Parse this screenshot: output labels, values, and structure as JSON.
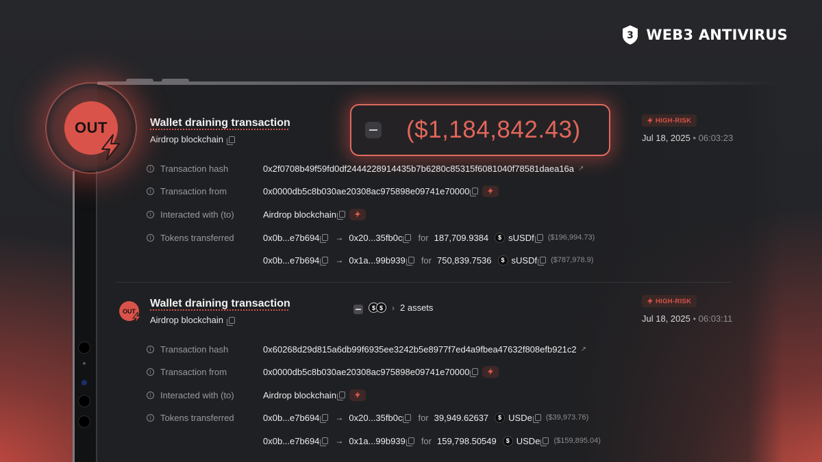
{
  "brand": {
    "name": "WEB3 ANTIVIRUS"
  },
  "colors": {
    "accent": "#d9534a",
    "background": "#1f2023",
    "text": "#ececee"
  },
  "transactions": [
    {
      "direction": "OUT",
      "title": "Wallet draining transaction",
      "chain": "Airdrop blockchain",
      "amount": "($1,184,842.43)",
      "risk": "HIGH-RISK",
      "date": "Jul 18, 2025",
      "time": "06:03:23",
      "labels": {
        "hash": "Transaction hash",
        "from": "Transaction from",
        "to": "Interacted with (to)",
        "tokens": "Tokens transferred"
      },
      "hash": "0x2f0708b49f59fd0df2444228914435b7b6280c85315f6081040f78581daea16a",
      "from": "0x0000db5c8b030ae20308ac975898e09741e70000",
      "to": "Airdrop blockchain",
      "transfers": [
        {
          "from": "0x0b...e7b694",
          "to": "0x20...35fb0c",
          "for": "for",
          "amount": "187,709.9384",
          "token": "sUSDf",
          "usd": "($196,994.73)",
          "icon": "dollar-slash-icon"
        },
        {
          "from": "0x0b...e7b694",
          "to": "0x1a...99b939",
          "for": "for",
          "amount": "750,839.7536",
          "token": "sUSDf",
          "usd": "($787,978.9)",
          "icon": "dollar-slash-icon"
        }
      ]
    },
    {
      "direction": "OUT",
      "title": "Wallet draining transaction",
      "chain": "Airdrop blockchain",
      "assets": "2 assets",
      "risk": "HIGH-RISK",
      "date": "Jul 18, 2025",
      "time": "06:03:11",
      "labels": {
        "hash": "Transaction hash",
        "from": "Transaction from",
        "to": "Interacted with (to)",
        "tokens": "Tokens transferred"
      },
      "hash": "0x60268d29d815a6db99f6935ee3242b5e8977f7ed4a9fbea47632f808efb921c2",
      "from": "0x0000db5c8b030ae20308ac975898e09741e70000",
      "to": "Airdrop blockchain",
      "transfers": [
        {
          "from": "0x0b...e7b694",
          "to": "0x20...35fb0c",
          "for": "for",
          "amount": "39,949.62637",
          "token": "USDe",
          "usd": "($39,973.76)",
          "icon": "dollar-coin-icon"
        },
        {
          "from": "0x0b...e7b694",
          "to": "0x1a...99b939",
          "for": "for",
          "amount": "159,798.50549",
          "token": "USDe",
          "usd": "($159,895.04)",
          "icon": "dollar-coin-icon"
        }
      ]
    }
  ]
}
